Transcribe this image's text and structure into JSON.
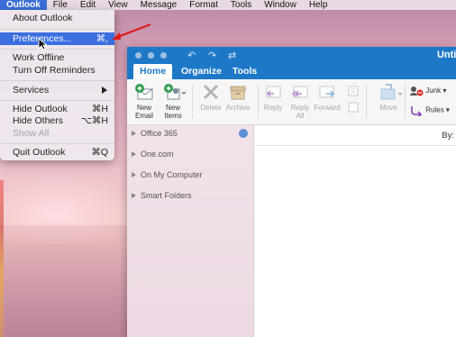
{
  "menubar": {
    "items": [
      "Outlook",
      "File",
      "Edit",
      "View",
      "Message",
      "Format",
      "Tools",
      "Window",
      "Help"
    ]
  },
  "menu": {
    "items": [
      {
        "label": "About Outlook",
        "shortcut": ""
      },
      {
        "label": "Preferences...",
        "shortcut": "⌘,"
      },
      {
        "label": "Work Offline",
        "shortcut": ""
      },
      {
        "label": "Turn Off Reminders",
        "shortcut": ""
      },
      {
        "label": "Services",
        "shortcut": ""
      },
      {
        "label": "Hide Outlook",
        "shortcut": "⌘H"
      },
      {
        "label": "Hide Others",
        "shortcut": "⌥⌘H"
      },
      {
        "label": "Show All",
        "shortcut": ""
      },
      {
        "label": "Quit Outlook",
        "shortcut": "⌘Q"
      }
    ]
  },
  "window": {
    "title": "Untit",
    "tabs": [
      "Home",
      "Organize",
      "Tools"
    ],
    "ribbon": {
      "new_email": [
        "New",
        "Email"
      ],
      "new_items": [
        "New",
        "Items"
      ],
      "delete": "Delete",
      "archive": "Archive",
      "reply": "Reply",
      "reply_all": [
        "Reply",
        "All"
      ],
      "forward": "Forward",
      "move": "Move",
      "junk": "Junk",
      "rules": "Rules"
    },
    "folders": [
      "Office 365",
      "One.com",
      "On My Computer",
      "Smart Folders"
    ],
    "reading_by": "By:"
  },
  "colors": {
    "accent": "#1e78c8",
    "highlight": "#3b6fe0",
    "annotation": "#e0191b"
  }
}
